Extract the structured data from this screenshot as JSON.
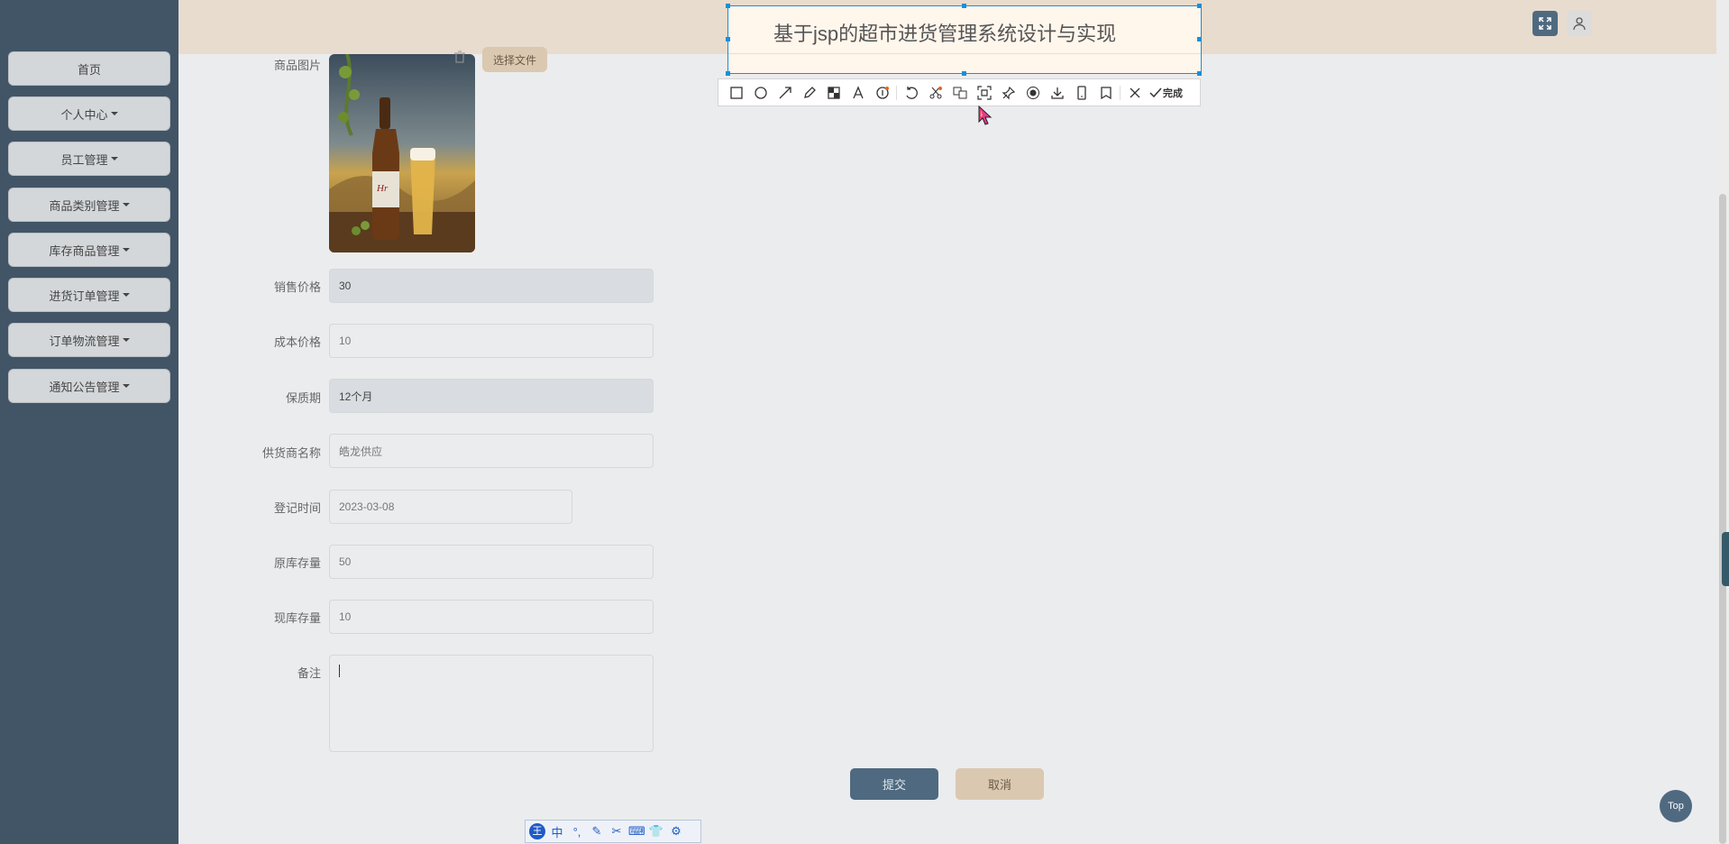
{
  "sidebar": {
    "items": [
      {
        "label": "首页",
        "has_caret": false
      },
      {
        "label": "个人中心",
        "has_caret": true
      },
      {
        "label": "员工管理",
        "has_caret": true
      },
      {
        "label": "商品类别管理",
        "has_caret": true
      },
      {
        "label": "库存商品管理",
        "has_caret": true
      },
      {
        "label": "进货订单管理",
        "has_caret": true
      },
      {
        "label": "订单物流管理",
        "has_caret": true
      },
      {
        "label": "通知公告管理",
        "has_caret": true
      }
    ]
  },
  "header": {
    "title": "基于jsp的超市进货管理系统设计与实现",
    "fullscreen_icon": "expand-icon",
    "user_icon": "user-icon"
  },
  "form": {
    "image_label": "商品图片",
    "choose_file_label": "选择文件",
    "fields": [
      {
        "label": "销售价格",
        "value": "30"
      },
      {
        "label": "成本价格",
        "value": "10"
      },
      {
        "label": "保质期",
        "value": "12个月"
      },
      {
        "label": "供货商名称",
        "value": "皓龙供应"
      },
      {
        "label": "登记时间",
        "value": "2023-03-08"
      },
      {
        "label": "原库存量",
        "value": "50"
      },
      {
        "label": "现库存量",
        "value": "10"
      },
      {
        "label": "备注",
        "value": ""
      }
    ],
    "submit_label": "提交",
    "cancel_label": "取消"
  },
  "screenshot_tool": {
    "done_label": "完成",
    "tools": [
      "rectangle-icon",
      "ellipse-icon",
      "arrow-icon",
      "pen-icon",
      "mosaic-icon",
      "text-icon",
      "number-icon",
      "undo-icon",
      "cut-icon",
      "translate-icon",
      "ocr-icon",
      "pin-icon",
      "record-icon",
      "download-icon",
      "phone-icon",
      "bookmark-icon",
      "close-icon",
      "check-icon"
    ]
  },
  "top_button_label": "Top",
  "ime": {
    "mode": "中"
  },
  "colors": {
    "sidebar": "#425566",
    "header": "#e8dccf",
    "submit": "#4f6a80",
    "cancel": "#dbc8b0",
    "selection": "#1a8fd6"
  }
}
